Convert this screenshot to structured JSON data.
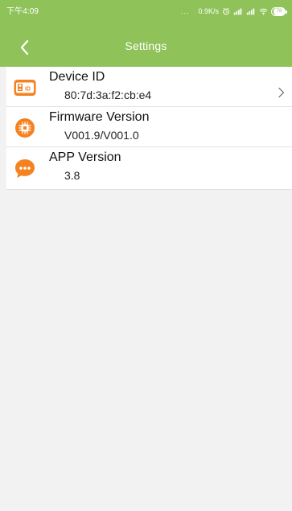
{
  "status_bar": {
    "time": "下午4:09",
    "dots": "...",
    "network_speed": "0.9K/s",
    "battery_level": "78",
    "alarm_icon": "alarm-icon",
    "signal_icon": "cellular-signal-icon",
    "wifi_icon": "wifi-icon",
    "battery_icon": "battery-icon"
  },
  "app_bar": {
    "title": "Settings",
    "back_icon": "chevron-left-icon"
  },
  "settings": {
    "items": [
      {
        "title": "Device ID",
        "value": "80:7d:3a:f2:cb:e4",
        "icon": "id-card-icon",
        "has_chevron": true
      },
      {
        "title": "Firmware Version",
        "value": "V001.9/V001.0",
        "icon": "chip-icon",
        "has_chevron": false
      },
      {
        "title": "APP Version",
        "value": "3.8",
        "icon": "chat-bubble-icon",
        "has_chevron": false
      }
    ]
  },
  "colors": {
    "header_green": "#8fc35a",
    "accent_orange": "#f58220",
    "page_background": "#f2f2f2",
    "divider": "#e2e2e2"
  }
}
